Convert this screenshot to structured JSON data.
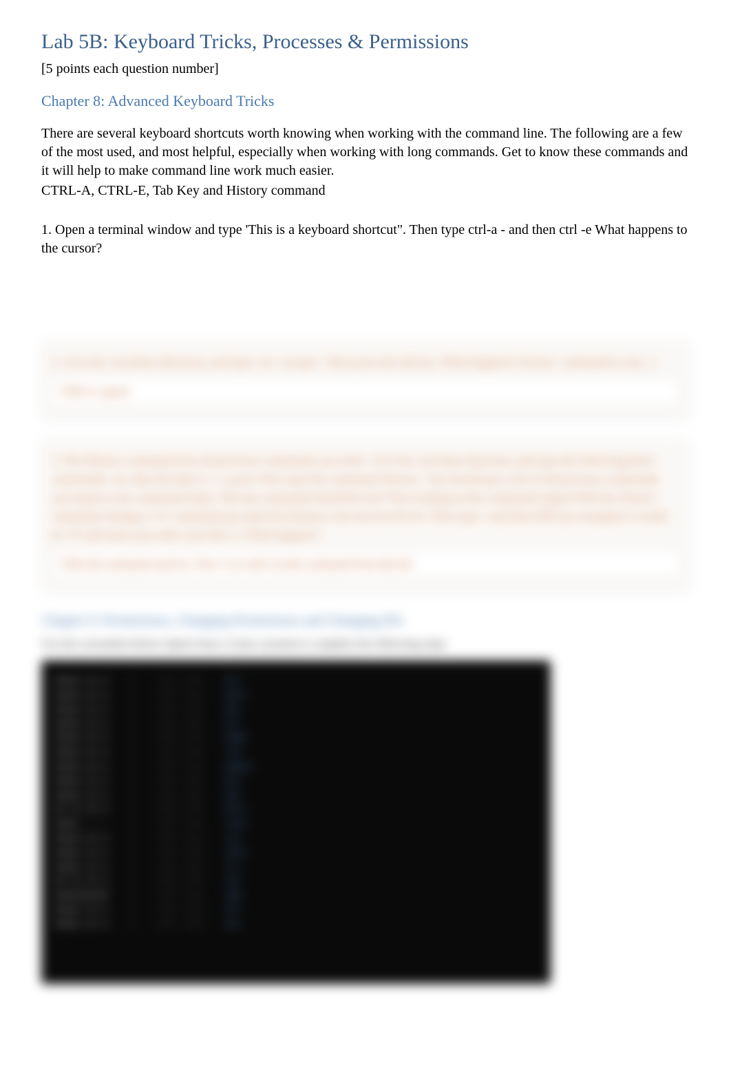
{
  "title": "Lab 5B: Keyboard Tricks, Processes & Permissions",
  "subtitle": "[5 points each question number]",
  "chapter8_heading": "Chapter 8: Advanced Keyboard Tricks",
  "intro_p1": "There are several keyboard shortcuts worth knowing when working with the command line.           The following are a few of the most used, and most helpful, especially when working with long commands.  Get to know these commands and it will help to make command line work much easier.",
  "intro_p2": "CTRL-A, CTRL-E, Tab Key and History command",
  "q1_text": "1.  Open a terminal window and type 'This is a keyboard shortcut\".         Then type ctrl-a - and then ctrl -e  What happens to the cursor?",
  "blurred": {
    "q2_text": "2.  cd to the /usr/share directory, and type 'cat <escape>' then press the tab key.           What happens? (Guess: command to run...)",
    "q2_answer": "TAB is a guess",
    "q3_text": "3.  The History command lists all previous commands you enter.        cd to the /usr/share directory and type the following three commands: cat, date the date           ls -l -a  pwd.  Now type the command 'history'.       You should get a list of all previous commands you typed so far command today.          The last command should be list?    Now looking at the command output With the 'history' command, listings is 'ls' command put until the bottom is the last list PLUS.          Then type  ! and then HIS (an example) it would be         '!9' and enter (you after your hits !).       What happens?",
    "q3_answer": "TAB old command used for. Now 5 its with 4 (with command from the) hit",
    "chapter9_heading": "Chapter 9: Permissions, Changing Permissions and Changing IDs",
    "chapter9_sub": "Use the screenshot below (taken from a Linux system) to complete the following steps"
  }
}
